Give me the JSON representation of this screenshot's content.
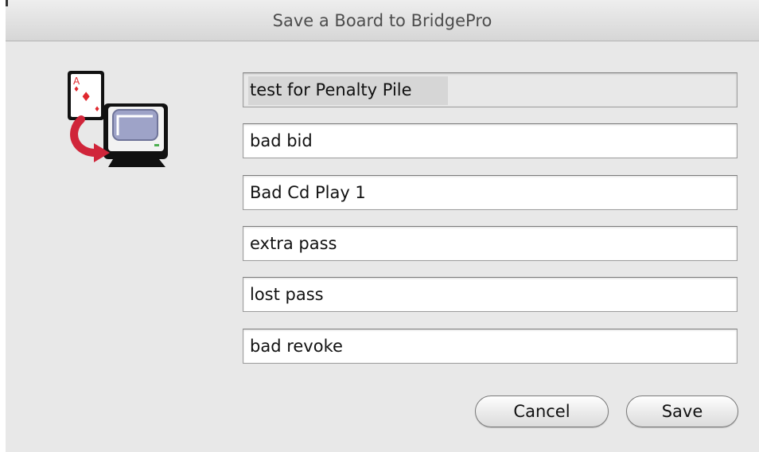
{
  "window": {
    "title": "Save a Board to BridgePro"
  },
  "icon": {
    "name": "card-to-computer-icon",
    "card_rank": "A",
    "card_suit": "♦",
    "card_color": "#e0282e",
    "arrow_color": "#d0253a"
  },
  "fields": [
    {
      "id": "board-title",
      "value": "test for Penalty Pile",
      "selected": true
    },
    {
      "id": "note-1",
      "value": "bad bid"
    },
    {
      "id": "note-2",
      "value": "Bad Cd Play 1"
    },
    {
      "id": "note-3",
      "value": "extra pass"
    },
    {
      "id": "note-4",
      "value": "lost pass"
    },
    {
      "id": "note-5",
      "value": "bad revoke"
    }
  ],
  "buttons": {
    "cancel_label": "Cancel",
    "save_label": "Save"
  }
}
